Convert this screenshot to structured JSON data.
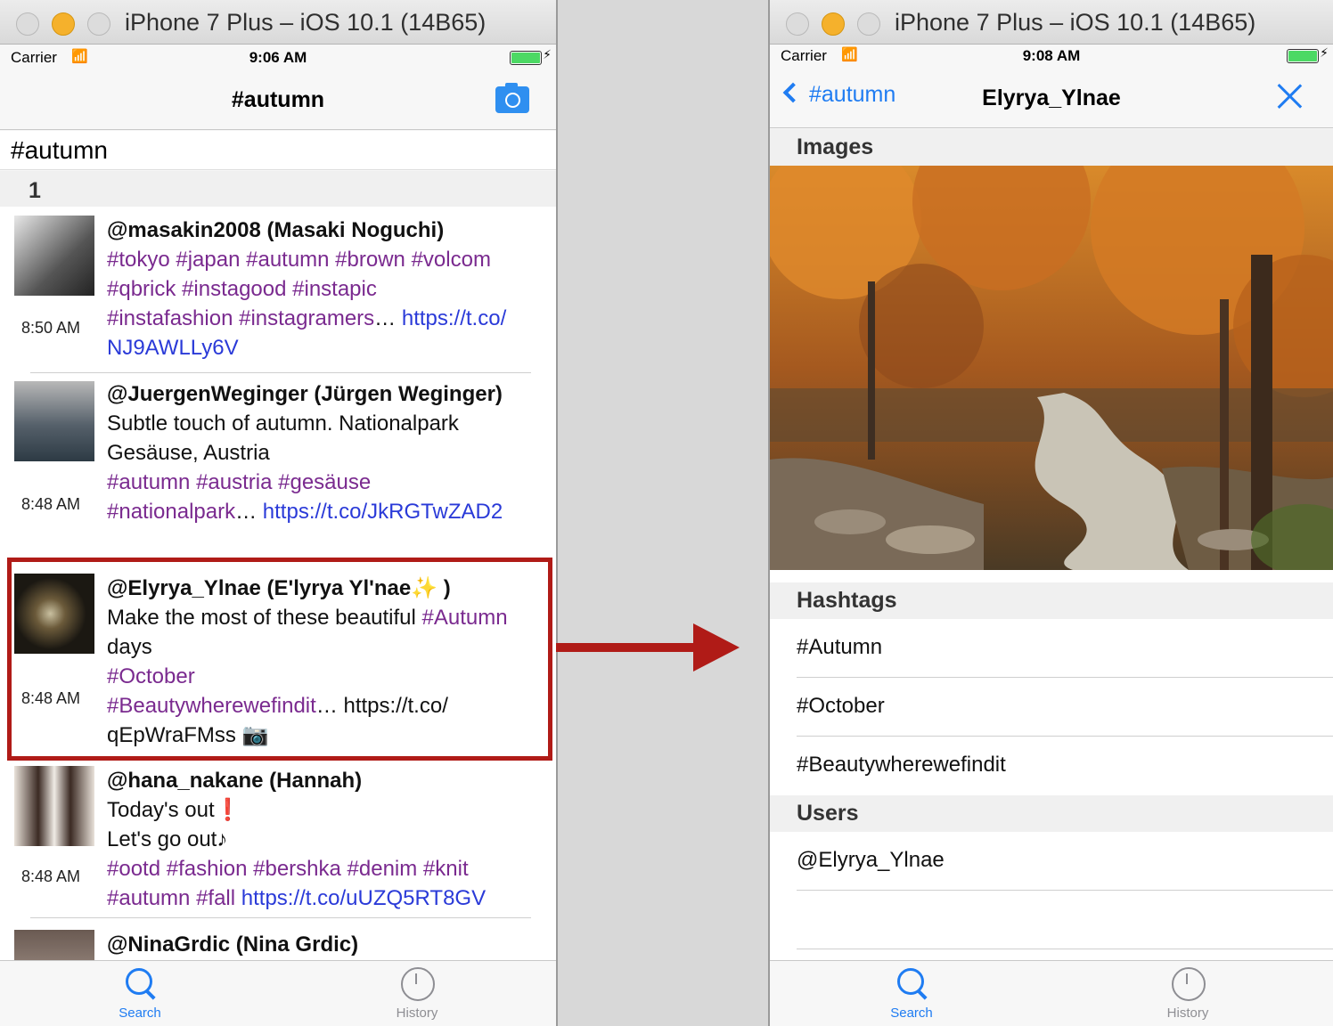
{
  "left_window": {
    "title": "iPhone 7 Plus – iOS 10.1 (14B65)",
    "status": {
      "carrier": "Carrier",
      "time": "9:06 AM"
    },
    "nav_title": "#autumn",
    "search_value": "#autumn",
    "section_header": "1",
    "tweets": [
      {
        "author": "@masakin2008 (Masaki Noguchi)",
        "time": "8:50 AM",
        "lines": [
          [
            {
              "t": "#tokyo #japan #autumn #brown #volcom",
              "c": "tag"
            }
          ],
          [
            {
              "t": "#qbrick #instagood #instapic",
              "c": "tag"
            }
          ],
          [
            {
              "t": "#instafashion #instagramers",
              "c": "tag"
            },
            {
              "t": "… ",
              "c": ""
            },
            {
              "t": "https://t.co/",
              "c": "link"
            }
          ],
          [
            {
              "t": "NJ9AWLLy6V",
              "c": "link"
            }
          ]
        ]
      },
      {
        "author": "@JuergenWeginger (Jürgen Weginger)",
        "time": "8:48 AM",
        "lines": [
          [
            {
              "t": "Subtle touch of autumn. Nationalpark",
              "c": ""
            }
          ],
          [
            {
              "t": "Gesäuse, Austria",
              "c": ""
            }
          ],
          [
            {
              "t": " ",
              "c": ""
            }
          ],
          [
            {
              "t": "#autumn #austria #gesäuse",
              "c": "tag"
            }
          ],
          [
            {
              "t": "#nationalpark",
              "c": "tag"
            },
            {
              "t": "… ",
              "c": ""
            },
            {
              "t": "https://t.co/JkRGTwZAD2",
              "c": "link"
            }
          ]
        ]
      },
      {
        "author": "@Elyrya_Ylnae (E'lyrya Yl'nae✨ )",
        "time": "8:48 AM",
        "lines": [
          [
            {
              "t": "Make the most of these beautiful ",
              "c": ""
            },
            {
              "t": "#Autumn",
              "c": "tag"
            }
          ],
          [
            {
              "t": "days",
              "c": ""
            }
          ],
          [
            {
              "t": "#October",
              "c": "tag"
            }
          ],
          [
            {
              "t": "#Beautywherewefindit",
              "c": "tag"
            },
            {
              "t": "… https://t.co/",
              "c": ""
            }
          ],
          [
            {
              "t": "qEpWraFMss 📷",
              "c": ""
            }
          ]
        ]
      },
      {
        "author": "@hana_nakane (Hannah)",
        "time": "8:48 AM",
        "lines": [
          [
            {
              "t": "Today's out❗",
              "c": ""
            }
          ],
          [
            {
              "t": "Let's go out♪",
              "c": ""
            }
          ],
          [
            {
              "t": "#ootd #fashion #bershka #denim #knit",
              "c": "tag"
            }
          ],
          [
            {
              "t": "#autumn #fall ",
              "c": "tag"
            },
            {
              "t": "https://t.co/uUZQ5RT8GV",
              "c": "link"
            }
          ]
        ]
      },
      {
        "author": "@NinaGrdic (Nina Grdic)",
        "time": "",
        "lines": []
      }
    ],
    "tabs": {
      "search": "Search",
      "history": "History"
    }
  },
  "right_window": {
    "title": "iPhone 7 Plus – iOS 10.1 (14B65)",
    "status": {
      "carrier": "Carrier",
      "time": "9:08 AM"
    },
    "back_label": "#autumn",
    "nav_title": "Elyrya_Ylnae",
    "sections": {
      "images": "Images",
      "hashtags": "Hashtags",
      "users": "Users"
    },
    "hashtags": [
      "#Autumn",
      "#October",
      "#Beautywherewefindit"
    ],
    "users": [
      "@Elyrya_Ylnae"
    ],
    "tabs": {
      "search": "Search",
      "history": "History"
    }
  },
  "colors": {
    "accent": "#1f7cf2",
    "hashtag": "#7a2a8f",
    "link": "#2a3ad8",
    "highlight": "#b01b17"
  }
}
